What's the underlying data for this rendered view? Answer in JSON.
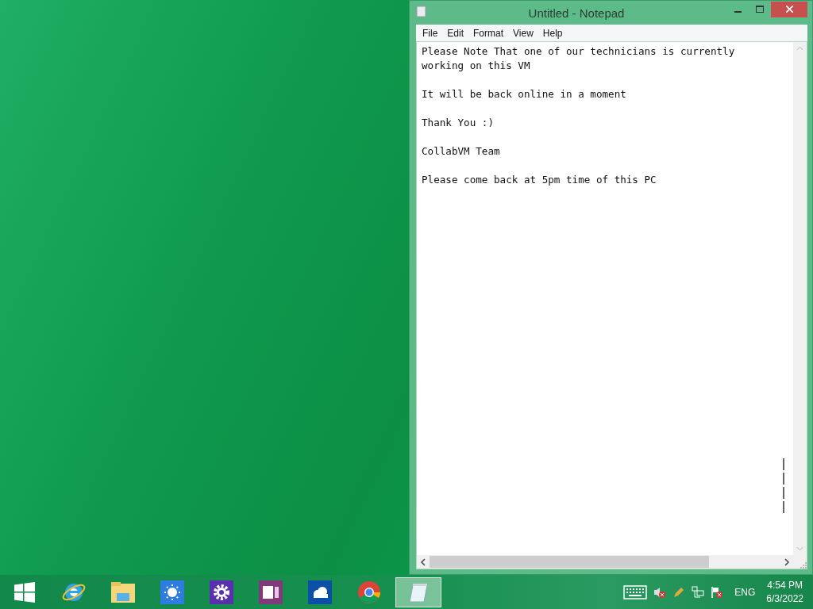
{
  "window": {
    "title": "Untitled - Notepad"
  },
  "menu": [
    "File",
    "Edit",
    "Format",
    "View",
    "Help"
  ],
  "document": {
    "paragraphs": [
      [
        "Please Note That one of our technicians is currently",
        "working on this VM"
      ],
      [
        "It will be back online in a moment"
      ],
      [
        "Thank You :)"
      ],
      [
        "CollabVM Team"
      ],
      [
        "Please come back at 5pm time of this PC"
      ]
    ]
  },
  "taskbar": {
    "apps": [
      {
        "kind": "ie",
        "selected": false
      },
      {
        "kind": "explorer",
        "selected": false
      },
      {
        "kind": "weather",
        "selected": false
      },
      {
        "kind": "settings",
        "selected": false
      },
      {
        "kind": "onenote",
        "selected": false
      },
      {
        "kind": "onedrive",
        "selected": false
      },
      {
        "kind": "chrome",
        "selected": false
      },
      {
        "kind": "notepad",
        "selected": true
      }
    ]
  },
  "tray": {
    "language": "ENG",
    "time": "4:54 PM",
    "date": "6/3/2022"
  }
}
